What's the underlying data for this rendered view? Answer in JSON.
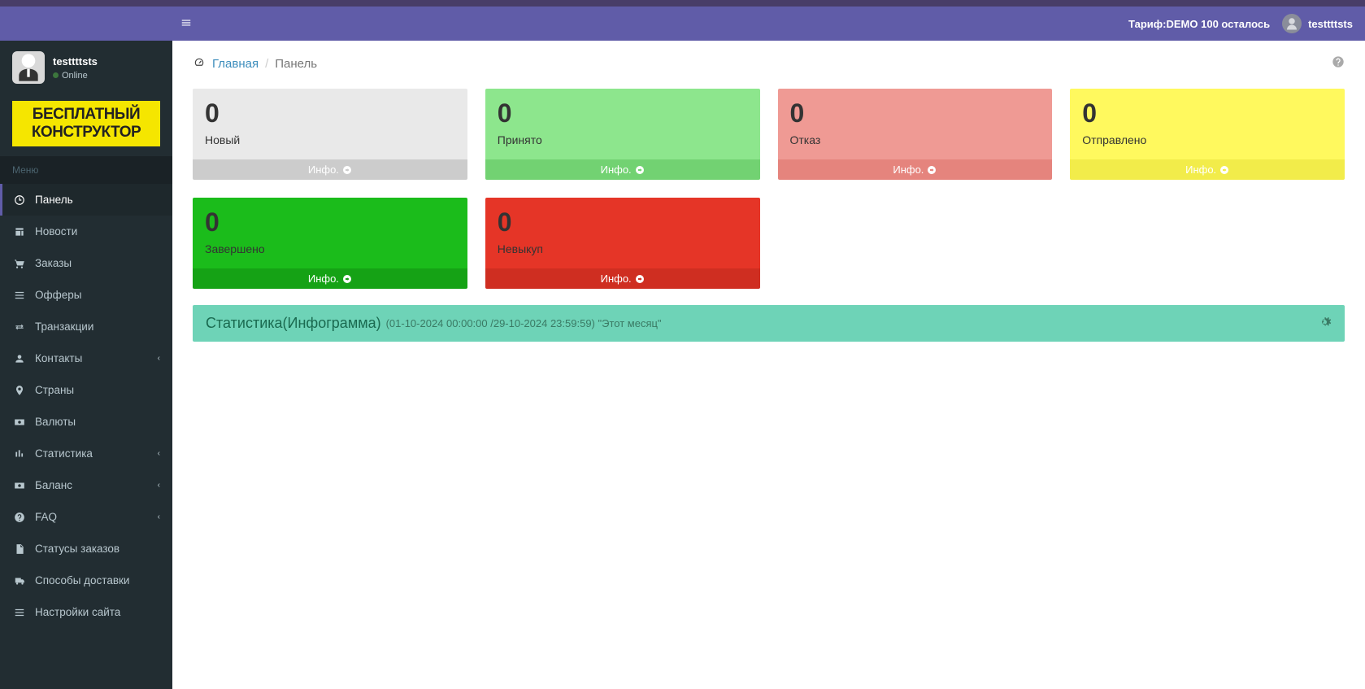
{
  "header": {
    "tariff": "Тариф:DEMO 100 осталось",
    "username": "testtttsts"
  },
  "user_panel": {
    "name": "testtttsts",
    "status": "Online"
  },
  "logo": {
    "line1": "БЕСПЛАТНЫЙ",
    "line2": "КОНСТРУКТОР"
  },
  "menu_header": "Меню",
  "sidebar": {
    "items": [
      {
        "label": "Панель",
        "active": true,
        "icon": "dashboard"
      },
      {
        "label": "Новости",
        "icon": "news"
      },
      {
        "label": "Заказы",
        "icon": "cart"
      },
      {
        "label": "Офферы",
        "icon": "list"
      },
      {
        "label": "Транзакции",
        "icon": "exchange"
      },
      {
        "label": "Контакты",
        "has_arrow": true,
        "icon": "users"
      },
      {
        "label": "Страны",
        "icon": "marker"
      },
      {
        "label": "Валюты",
        "icon": "money"
      },
      {
        "label": "Статистика",
        "has_arrow": true,
        "icon": "bar"
      },
      {
        "label": "Баланс",
        "has_arrow": true,
        "icon": "money"
      },
      {
        "label": "FAQ",
        "has_arrow": true,
        "icon": "question"
      },
      {
        "label": "Статусы заказов",
        "icon": "file"
      },
      {
        "label": "Способы доставки",
        "icon": "truck"
      },
      {
        "label": "Настройки сайта",
        "icon": "list"
      }
    ]
  },
  "breadcrumb": {
    "home": "Главная",
    "current": "Панель"
  },
  "cards": [
    {
      "value": "0",
      "label": "Новый",
      "link": "Инфо.",
      "color": "gray"
    },
    {
      "value": "0",
      "label": "Принято",
      "link": "Инфо.",
      "color": "green"
    },
    {
      "value": "0",
      "label": "Отказ",
      "link": "Инфо.",
      "color": "red"
    },
    {
      "value": "0",
      "label": "Отправлено",
      "link": "Инфо.",
      "color": "yellow"
    },
    {
      "value": "0",
      "label": "Завершено",
      "link": "Инфо.",
      "color": "darkgreen"
    },
    {
      "value": "0",
      "label": "Невыкуп",
      "link": "Инфо.",
      "color": "darkred"
    }
  ],
  "stat_panel": {
    "title": "Статистика(Инфограмма)",
    "sub": "(01-10-2024 00:00:00 /29-10-2024 23:59:59) \"Этот месяц\""
  }
}
